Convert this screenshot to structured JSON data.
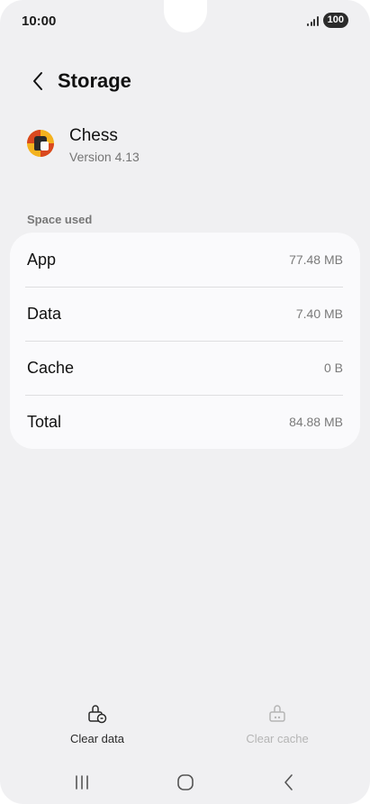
{
  "status_bar": {
    "time": "10:00",
    "battery": "100",
    "icons": [
      "signal-icon",
      "battery-icon"
    ]
  },
  "header": {
    "title": "Storage",
    "back_icon": "chevron-left-icon"
  },
  "app": {
    "name": "Chess",
    "version": "Version 4.13",
    "icon": "chess-app-icon"
  },
  "storage": {
    "section_label": "Space used",
    "rows": [
      {
        "label": "App",
        "value": "77.48 MB"
      },
      {
        "label": "Data",
        "value": "7.40 MB"
      },
      {
        "label": "Cache",
        "value": "0 B"
      },
      {
        "label": "Total",
        "value": "84.88 MB"
      }
    ]
  },
  "actions": {
    "clear_data": {
      "label": "Clear data",
      "icon": "brush-icon",
      "enabled": true
    },
    "clear_cache": {
      "label": "Clear cache",
      "icon": "brush-icon",
      "enabled": false
    }
  },
  "nav_bar": {
    "icons": [
      "recents-icon",
      "home-icon",
      "back-icon"
    ]
  },
  "colors": {
    "background": "#f0f0f2",
    "card": "#fafafc",
    "disabled_text": "#b5b5b5",
    "secondary_text": "#7a7a7a"
  }
}
